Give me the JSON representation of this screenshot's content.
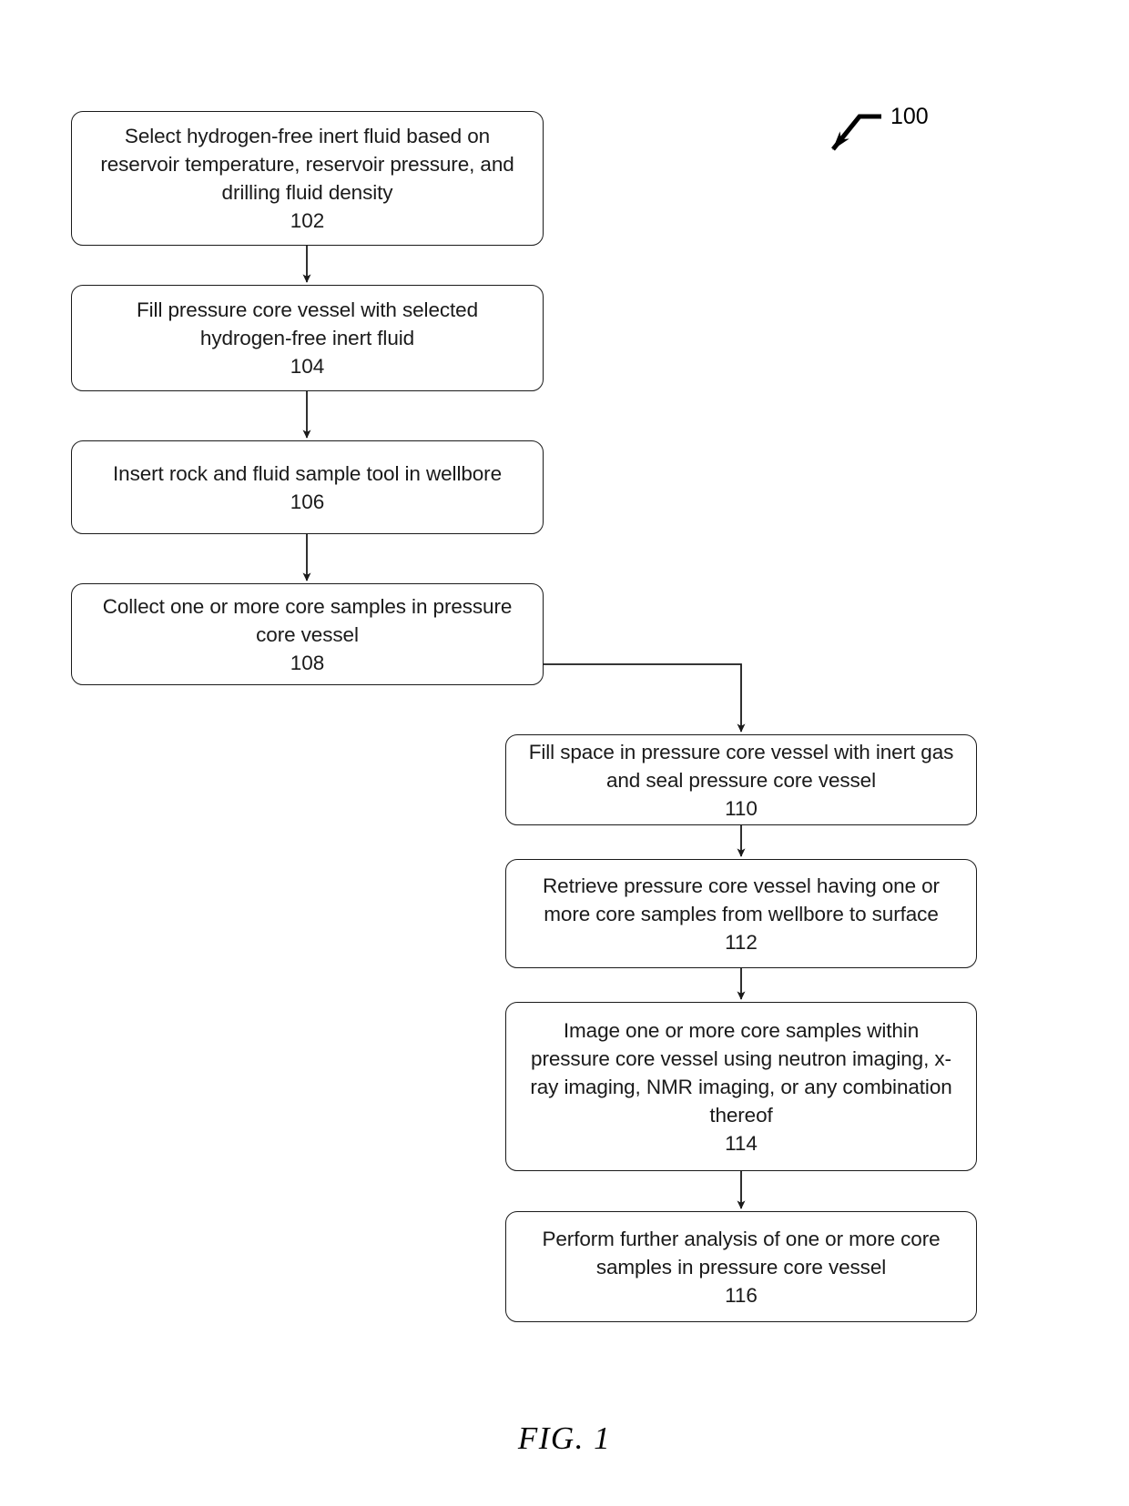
{
  "figure": {
    "caption": "FIG. 1",
    "reference_numeral": "100"
  },
  "flowchart": {
    "type": "process-flow",
    "orientation": "two-column-vertical",
    "steps": [
      {
        "id": "102",
        "ref": "102",
        "text": "Select hydrogen-free inert fluid based on\nreservoir temperature, reservoir pressure, and\ndrilling fluid density",
        "column": "left"
      },
      {
        "id": "104",
        "ref": "104",
        "text": "Fill pressure core vessel with selected\nhydrogen-free inert fluid",
        "column": "left"
      },
      {
        "id": "106",
        "ref": "106",
        "text": "Insert rock and fluid sample tool in wellbore",
        "column": "left"
      },
      {
        "id": "108",
        "ref": "108",
        "text": "Collect one or more core samples in pressure\ncore vessel",
        "column": "left"
      },
      {
        "id": "110",
        "ref": "110",
        "text": "Fill space in pressure core vessel with inert gas\nand seal pressure core vessel",
        "column": "right"
      },
      {
        "id": "112",
        "ref": "112",
        "text": "Retrieve  pressure core vessel having one or\nmore core samples from wellbore to surface",
        "column": "right"
      },
      {
        "id": "114",
        "ref": "114",
        "text": "Image one or more core samples within\npressure core vessel using neutron imaging, x-\nray imaging, NMR imaging, or any combination\nthereof",
        "column": "right"
      },
      {
        "id": "116",
        "ref": "116",
        "text": "Perform further analysis of one or more core\nsamples in pressure core vessel",
        "column": "right"
      }
    ],
    "connectors": [
      {
        "from": "102",
        "to": "104",
        "style": "straight-down-arrow"
      },
      {
        "from": "104",
        "to": "106",
        "style": "straight-down-arrow"
      },
      {
        "from": "106",
        "to": "108",
        "style": "straight-down-arrow"
      },
      {
        "from": "108",
        "to": "110",
        "style": "elbow-right-then-down-arrow"
      },
      {
        "from": "110",
        "to": "112",
        "style": "straight-down-arrow"
      },
      {
        "from": "112",
        "to": "114",
        "style": "straight-down-arrow"
      },
      {
        "from": "114",
        "to": "116",
        "style": "straight-down-arrow"
      }
    ]
  },
  "style": {
    "line_color": "#1a1a1a",
    "background_color": "#ffffff",
    "text_color": "#1a1a1a"
  }
}
